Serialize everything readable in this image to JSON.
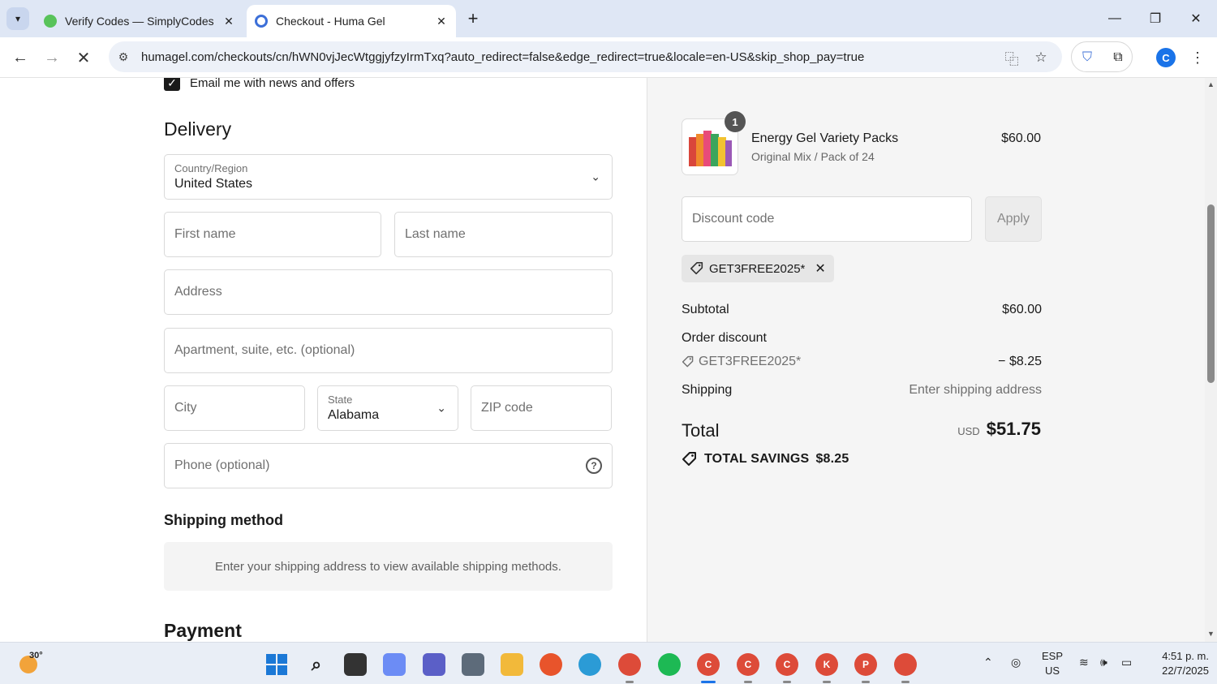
{
  "browser": {
    "tabs": [
      {
        "title": "Verify Codes — SimplyCodes"
      },
      {
        "title": "Checkout - Huma Gel"
      }
    ],
    "url": "humagel.com/checkouts/cn/hWN0vjJecWtggjyfzyIrmTxq?auto_redirect=false&edge_redirect=true&locale=en-US&skip_shop_pay=true",
    "profile_initial": "C"
  },
  "form": {
    "email_opt_in_label": "Email me with news and offers",
    "delivery_heading": "Delivery",
    "country": {
      "label": "Country/Region",
      "value": "United States"
    },
    "first_name_placeholder": "First name",
    "last_name_placeholder": "Last name",
    "address_placeholder": "Address",
    "apartment_placeholder": "Apartment, suite, etc. (optional)",
    "city_placeholder": "City",
    "state": {
      "label": "State",
      "value": "Alabama"
    },
    "zip_placeholder": "ZIP code",
    "phone_placeholder": "Phone (optional)",
    "shipping_method_heading": "Shipping method",
    "shipping_method_notice": "Enter your shipping address to view available shipping methods.",
    "payment_heading": "Payment"
  },
  "summary": {
    "product": {
      "quantity": "1",
      "name": "Energy Gel Variety Packs",
      "variant": "Original Mix / Pack of 24",
      "price": "$60.00"
    },
    "discount_placeholder": "Discount code",
    "apply_label": "Apply",
    "applied_code": "GET3FREE2025*",
    "subtotal_label": "Subtotal",
    "subtotal_value": "$60.00",
    "order_discount_label": "Order discount",
    "order_discount_code": "GET3FREE2025*",
    "order_discount_value": "− $8.25",
    "shipping_label": "Shipping",
    "shipping_value": "Enter shipping address",
    "total_label": "Total",
    "total_currency": "USD",
    "total_value": "$51.75",
    "savings_label": "TOTAL SAVINGS",
    "savings_value": "$8.25"
  },
  "taskbar": {
    "weather_temp": "30°",
    "language_line1": "ESP",
    "language_line2": "US",
    "time": "4:51 p. m.",
    "date": "22/7/2025",
    "pinned_badges": [
      "C",
      "C",
      "C",
      "K",
      "P"
    ]
  },
  "colors": {
    "tabbar_bg": "#dfe7f5",
    "summary_bg": "#f5f5f5",
    "chrome_accent": "#1a73e8"
  }
}
